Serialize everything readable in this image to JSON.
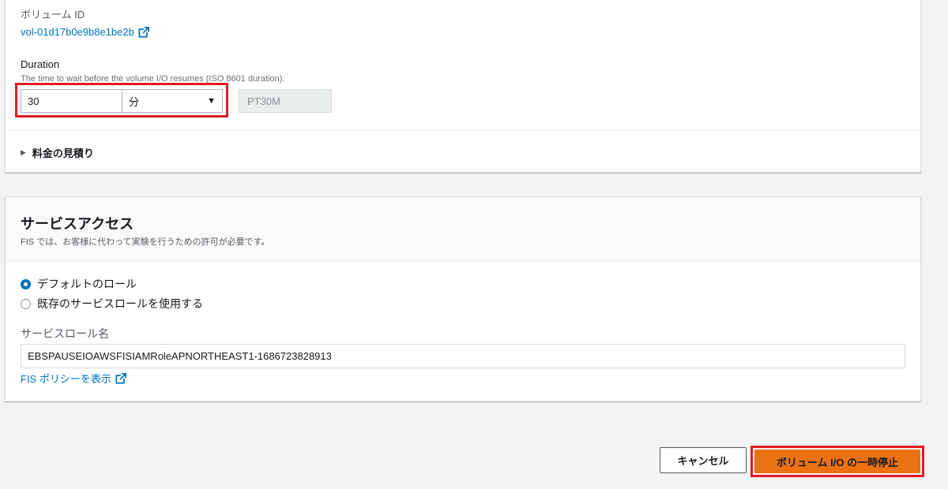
{
  "volume": {
    "label": "ボリューム ID",
    "id_link": "vol-01d17b0e9b8e1be2b"
  },
  "duration": {
    "label": "Duration",
    "description": "The time to wait before the volume I/O resumes (ISO 8601 duration).",
    "value": "30",
    "unit": "分",
    "iso": "PT30M"
  },
  "pricing": {
    "label": "料金の見積り"
  },
  "service_access": {
    "title": "サービスアクセス",
    "subtitle": "FIS では、お客様に代わって実験を行うための許可が必要です。",
    "options": [
      {
        "label": "デフォルトのロール",
        "checked": true
      },
      {
        "label": "既存のサービスロールを使用する",
        "checked": false
      }
    ],
    "role_name_label": "サービスロール名",
    "role_name_value": "EBSPAUSEIOAWSFISIAMRoleAPNORTHEAST1-1686723828913",
    "policy_link": "FIS ポリシーを表示"
  },
  "actions": {
    "cancel": "キャンセル",
    "submit": "ボリューム I/O の一時停止"
  },
  "colors": {
    "link": "#0073bb",
    "primary": "#ec7211",
    "highlight": "#e01b24"
  }
}
